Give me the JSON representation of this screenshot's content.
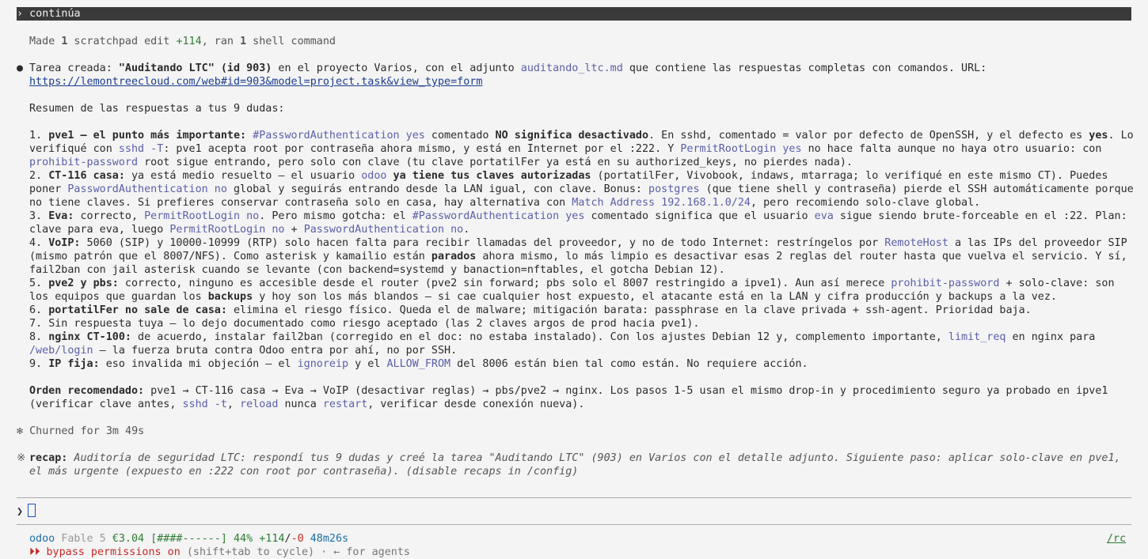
{
  "prompt": {
    "symbol": "›",
    "text": "continúa"
  },
  "meta": {
    "prefix": "Made ",
    "num1": "1",
    "mid1": " scratchpad edit ",
    "added": "+114",
    "mid2": ", ran ",
    "num2": "1",
    "suffix": " shell command"
  },
  "bullet": "●",
  "l1": {
    "a": "Tarea creada: ",
    "b": "\"Auditando LTC\" (id 903)",
    "c": " en el proyecto Varios, con el adjunto ",
    "d": "auditando_ltc.md",
    "e": " que contiene las respuestas completas con comandos. URL:",
    "url": "https://lemontreecloud.com/web#id=903&model=project.task&view_type=form"
  },
  "summary": "Resumen de las respuestas a tus 9 dudas:",
  "i1": {
    "n": "1. ",
    "b1": "pve1 — el punto más importante:",
    "t1": " ",
    "c1": "#PasswordAuthentication yes",
    "t2": " comentado ",
    "b2": "NO significa desactivado",
    "t3": ". En sshd, comentado = valor por defecto de OpenSSH, y el defecto es ",
    "b3": "yes",
    "t4": ". Lo verifiqué con ",
    "c2": "sshd -T",
    "t5": ": pve1 acepta root por contraseña ahora mismo, y está en Internet por el :222. Y ",
    "c3": "PermitRootLogin yes",
    "t6": " no hace falta aunque no haya otro usuario: con ",
    "c4": "prohibit-password",
    "t7": " root sigue entrando, pero solo con clave (tu clave portatilFer ya está en su authorized_keys, no pierdes nada)."
  },
  "i2": {
    "n": "2. ",
    "b1": "CT-116 casa:",
    "t1": " ya está medio resuelto — el usuario ",
    "c1": "odoo",
    "t2": " ",
    "b2": "ya tiene tus claves autorizadas",
    "t3": " (portatilFer, Vivobook, indaws, mtarraga; lo verifiqué en este mismo CT). Puedes poner ",
    "c2": "PasswordAuthentication no",
    "t4": " global y seguirás entrando desde la LAN igual, con clave. Bonus: ",
    "c3": "postgres",
    "t5": " (que tiene shell y contraseña) pierde el SSH automáticamente porque no tiene claves. Si prefieres conservar contraseña solo en casa, hay alternativa con ",
    "c4": "Match Address 192.168.1.0/24",
    "t6": ", pero recomiendo solo-clave global."
  },
  "i3": {
    "n": "3. ",
    "b1": "Eva:",
    "t1": " correcto, ",
    "c1": "PermitRootLogin no",
    "t2": ". Pero mismo gotcha: el ",
    "c2": "#PasswordAuthentication yes",
    "t3": " comentado significa que el usuario ",
    "c3": "eva",
    "t4": " sigue siendo brute-forceable en el :22. Plan: clave para eva, luego ",
    "c4": "PermitRootLogin no",
    "t5": " + ",
    "c5": "PasswordAuthentication no",
    "t6": "."
  },
  "i4": {
    "n": "4. ",
    "b1": "VoIP:",
    "t1": " 5060 (SIP) y 10000-10999 (RTP) solo hacen falta para recibir llamadas del proveedor, y no de todo Internet: restríngelos por ",
    "c1": "RemoteHost",
    "t2": " a las IPs del proveedor SIP (mismo patrón que el 8007/NFS). Como asterisk y kamailio están ",
    "b2": "parados",
    "t3": " ahora mismo, lo más limpio es desactivar esas 2 reglas del router hasta que vuelva el servicio. Y sí, fail2ban con jail asterisk cuando se levante (con backend=systemd y banaction=nftables, el gotcha Debian 12)."
  },
  "i5": {
    "n": "5. ",
    "b1": "pve2 y pbs:",
    "t1": " correcto, ninguno es accesible desde el router (pve2 sin forward; pbs solo el 8007 restringido a ipve1). Aun así merece ",
    "c1": "prohibit-password",
    "t2": " + solo-clave: son los equipos que guardan los ",
    "b2": "backups",
    "t3": " y hoy son los más blandos — si cae cualquier host expuesto, el atacante está en la LAN y cifra producción y backups a la vez."
  },
  "i6": {
    "n": "6. ",
    "b1": "portatilFer no sale de casa:",
    "t1": " elimina el riesgo físico. Queda el de malware; mitigación barata: passphrase en la clave privada + ssh-agent. Prioridad baja."
  },
  "i7": {
    "n": "7. ",
    "t1": "Sin respuesta tuya — lo dejo documentado como riesgo aceptado (las 2 claves argos de prod hacia pve1)."
  },
  "i8": {
    "n": "8. ",
    "b1": "nginx CT-100:",
    "t1": " de acuerdo, instalar fail2ban (corregido en el doc: no estaba instalado). Con los ajustes Debian 12 y, complemento importante, ",
    "c1": "limit_req",
    "t2": " en nginx para ",
    "c2": "/web/login",
    "t3": " — la fuerza bruta contra Odoo entra por ahí, no por SSH."
  },
  "i9": {
    "n": "9. ",
    "b1": "IP fija:",
    "t1": " eso invalida mi objeción — el ",
    "c1": "ignoreip",
    "t2": " y el ",
    "c2": "ALLOW_FROM",
    "t3": " del 8006 están bien tal como están. No requiere acción."
  },
  "order": {
    "b1": "Orden recomendado:",
    "t1": " pve1 → CT-116 casa → Eva → VoIP (desactivar reglas) → pbs/pve2 → nginx. Los pasos 1-5 usan el mismo drop-in y procedimiento seguro ya probado en ipve1 (verificar clave antes, ",
    "c1": "sshd -t",
    "t2": ", ",
    "c2": "reload",
    "t3": " nunca ",
    "c3": "restart",
    "t4": ", verificar desde conexión nueva)."
  },
  "churn": "✻ Churned for 3m 49s",
  "recap": {
    "star": "※",
    "label": "recap:",
    "text": " Auditoría de seguridad LTC: respondí tus 9 dudas y creé la tarea \"Auditando LTC\" (903) en Varios con el detalle adjunto. Siguiente paso: aplicar solo-clave en pve1, el más urgente (expuesto en :222 con root por contraseña). (disable recaps in /config)"
  },
  "input": {
    "symbol": "❯"
  },
  "status": {
    "project": "odoo",
    "model": "Fable 5",
    "cost": "€3.04",
    "bar": "[####------]",
    "pct": "44%",
    "added": "+114",
    "slash": "/",
    "removed": "-0",
    "time": "48m26s",
    "rc": "/rc"
  },
  "bypass": {
    "arrows": "⏵⏵ bypass permissions on",
    "rest": " (shift+tab to cycle) · ← for agents"
  }
}
